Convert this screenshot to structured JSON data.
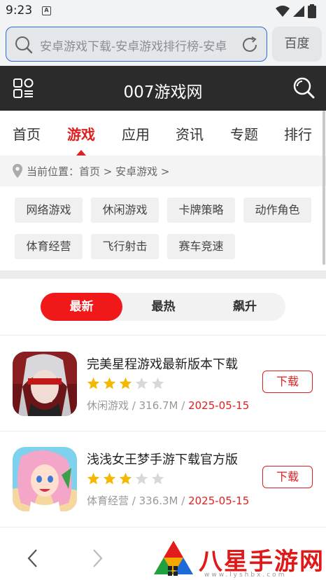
{
  "status": {
    "time": "9:23",
    "notif": "A"
  },
  "browser": {
    "url": "安卓游戏下载-安卓游戏排行榜-安卓",
    "baidu_label": "百度"
  },
  "site": {
    "title": "007游戏网"
  },
  "nav": {
    "items": [
      "首页",
      "游戏",
      "应用",
      "资讯",
      "专题",
      "排行"
    ],
    "active_index": 1
  },
  "breadcrumb": {
    "text": "当前位置：首页 > 安卓游戏 >"
  },
  "categories": [
    "网络游戏",
    "休闲游戏",
    "卡牌策略",
    "动作角色",
    "体育经营",
    "飞行射击",
    "赛车竞速"
  ],
  "tabs": {
    "items": [
      "最新",
      "最热",
      "飙升"
    ],
    "active_index": 0
  },
  "games": [
    {
      "title": "完美星程游戏最新版本下载",
      "rating": 3,
      "max_rating": 5,
      "category": "休闲游戏",
      "size": "316.7M",
      "date": "2025-05-15",
      "button": "下载",
      "sep": " / "
    },
    {
      "title": "浅浅女王梦手游下载官方版",
      "rating": 3,
      "max_rating": 5,
      "category": "体育经营",
      "size": "336.3M",
      "date": "2025-05-15",
      "button": "下载",
      "sep": " / "
    }
  ],
  "footer": {
    "logo_text": "八星手游网",
    "logo_url": "www.lyshbx.com"
  },
  "colors": {
    "accent": "#e02020",
    "header_bg": "#2b2b2b",
    "star_on": "#f5b800",
    "star_off": "#d8d8d8"
  }
}
